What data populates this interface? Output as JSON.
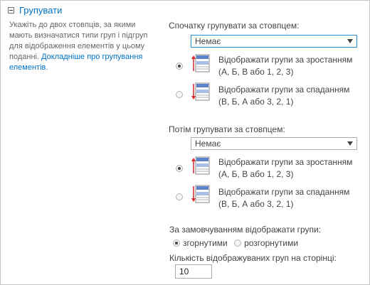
{
  "section": {
    "title": "Групувати",
    "description": "Укажіть до двох стовпців, за якими мають визначатися типи груп і підгруп для відображення елементів у цьому поданні.",
    "learn_more_link": "Докладніше про групування елементів."
  },
  "first_group": {
    "label": "Спочатку групувати за стовпцем:",
    "select_value": "Немає",
    "ascending": {
      "line1": "Відображати групи за зростанням",
      "line2": "(А, Б, В або 1, 2, 3)",
      "checked": true
    },
    "descending": {
      "line1": "Відображати групи за спаданням",
      "line2": "(В, Б, А або 3, 2, 1)",
      "checked": false
    }
  },
  "second_group": {
    "label": "Потім групувати за стовпцем:",
    "select_value": "Немає",
    "ascending": {
      "line1": "Відображати групи за зростанням",
      "line2": "(А, Б, В або 1, 2, 3)",
      "checked": true
    },
    "descending": {
      "line1": "Відображати групи за спаданням",
      "line2": "(В, Б, А або 3, 2, 1)",
      "checked": false
    }
  },
  "default_display": {
    "label": "За замовчуванням відображати групи:",
    "collapsed_label": "згорнутими",
    "expanded_label": "розгорнутими",
    "selected": "collapsed"
  },
  "groups_per_page": {
    "label": "Кількість відображуваних груп на сторінці:",
    "value": "10"
  },
  "icons": [
    "collapse-minus-icon",
    "dropdown-arrow-icon",
    "sort-ascending-icon",
    "sort-descending-icon"
  ],
  "colors": {
    "link": "#0072c6",
    "focus_border": "#2a8dd4",
    "icon_red": "#d9262c",
    "icon_blue": "#3f67b1"
  }
}
